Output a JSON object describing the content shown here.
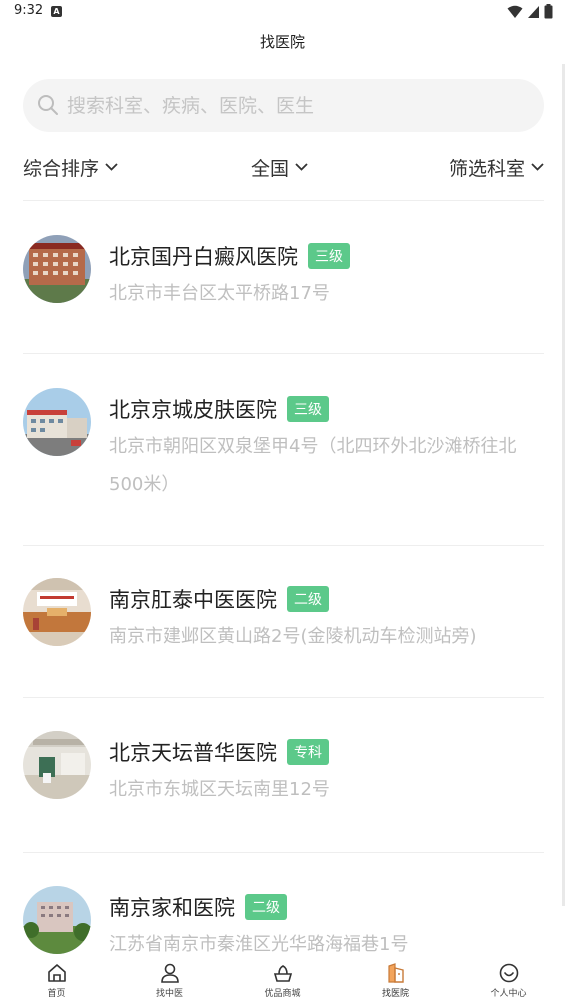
{
  "status_bar": {
    "time": "9:32",
    "notif_letter": "A"
  },
  "header": {
    "title": "找医院"
  },
  "search": {
    "placeholder": "搜索科室、疾病、医院、医生"
  },
  "filters": [
    {
      "label": "综合排序"
    },
    {
      "label": "全国"
    },
    {
      "label": "筛选科室"
    }
  ],
  "hospitals": [
    {
      "name": "北京国丹白癜风医院",
      "level": "三级",
      "address": "北京市丰台区太平桥路17号"
    },
    {
      "name": "北京京城皮肤医院",
      "level": "三级",
      "address": "北京市朝阳区双泉堡甲4号（北四环外北沙滩桥往北500米）"
    },
    {
      "name": "南京肛泰中医医院",
      "level": "二级",
      "address": "南京市建邺区黄山路2号(金陵机动车检测站旁)"
    },
    {
      "name": "北京天坛普华医院",
      "level": "专科",
      "address": "北京市东城区天坛南里12号"
    },
    {
      "name": "南京家和医院",
      "level": "二级",
      "address": "江苏省南京市秦淮区光华路海福巷1号"
    }
  ],
  "tabbar": {
    "items": [
      {
        "label": "首页",
        "icon": "home-icon"
      },
      {
        "label": "找中医",
        "icon": "doctor-icon"
      },
      {
        "label": "优品商城",
        "icon": "mall-icon"
      },
      {
        "label": "找医院",
        "icon": "hospital-icon",
        "active": true
      },
      {
        "label": "个人中心",
        "icon": "profile-icon"
      }
    ]
  },
  "colors": {
    "accent": "#5cc98a",
    "muted_text": "#bfbfbf",
    "search_bg": "#f4f4f4"
  }
}
